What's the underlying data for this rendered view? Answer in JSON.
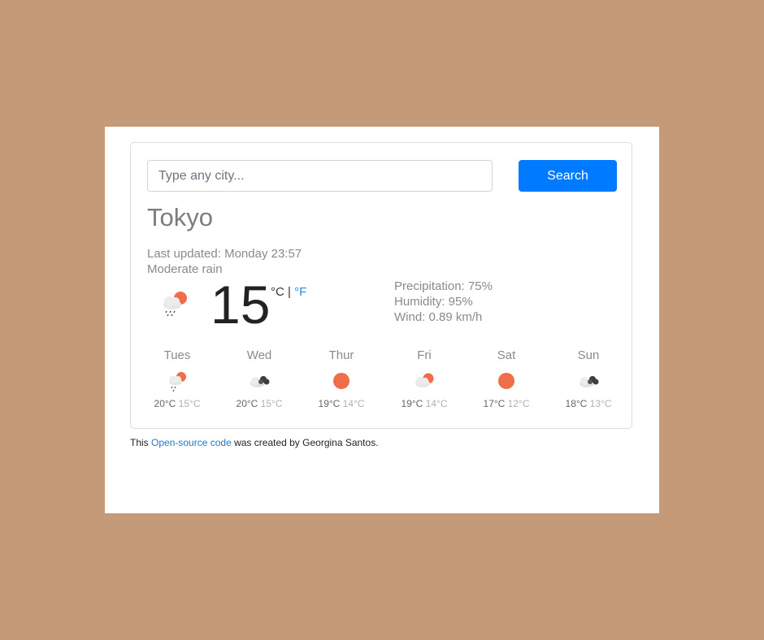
{
  "search": {
    "placeholder": "Type any city...",
    "button_label": "Search"
  },
  "current": {
    "city": "Tokyo",
    "last_updated": "Last updated: Monday 23:57",
    "description": "Moderate rain",
    "temperature": "15",
    "unit_celsius": "°C",
    "unit_separator": "|",
    "unit_fahrenheit": "°F",
    "icon": "rain-cloud-sun-icon",
    "precipitation": "Precipitation: 75%",
    "humidity": "Humidity: 95%",
    "wind": "Wind: 0.89 km/h"
  },
  "forecast": [
    {
      "day": "Tues",
      "max": "20°C",
      "min": "15°C",
      "icon": "rain-cloud-sun-icon"
    },
    {
      "day": "Wed",
      "max": "20°C",
      "min": "15°C",
      "icon": "dark-clouds-icon"
    },
    {
      "day": "Thur",
      "max": "19°C",
      "min": "14°C",
      "icon": "sun-icon"
    },
    {
      "day": "Fri",
      "max": "19°C",
      "min": "14°C",
      "icon": "cloud-sun-icon"
    },
    {
      "day": "Sat",
      "max": "17°C",
      "min": "12°C",
      "icon": "sun-icon"
    },
    {
      "day": "Sun",
      "max": "18°C",
      "min": "13°C",
      "icon": "dark-clouds-icon"
    }
  ],
  "footer": {
    "prefix": "This",
    "link_text": "Open-source code",
    "suffix": "was created by Georgina Santos."
  },
  "colors": {
    "background": "#c49a78",
    "accent": "#007bff",
    "sun": "#ee6e4a",
    "link": "#1f78c8"
  }
}
